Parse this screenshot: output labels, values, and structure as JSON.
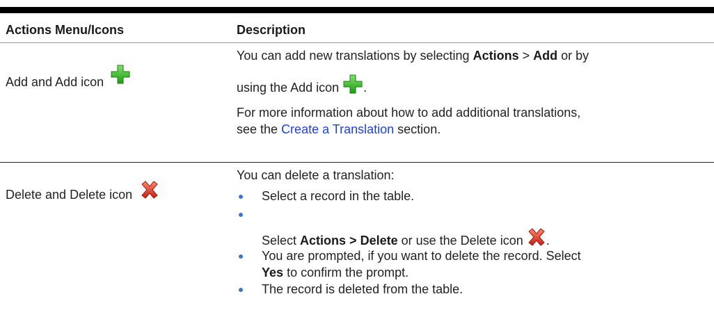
{
  "header": {
    "col1": "Actions Menu/Icons",
    "col2": "Description"
  },
  "row_add": {
    "label": "Add and Add icon",
    "icon": "green-plus-icon",
    "p1_text": "You can add new translations by selecting",
    "p1_b1": "Actions",
    "p1_sep": ">",
    "p1_b2": "Add",
    "p1_tail": "or by",
    "p2_text": "using the Add icon",
    "p2_end": ".",
    "p3_text": "For more information about how to add additional translations,",
    "p4_text": "see the",
    "p4_link": "Create a Translation",
    "p4_tail": "section."
  },
  "row_delete": {
    "label": "Delete and Delete icon",
    "icon": "red-x-icon",
    "intro": "You can delete a translation:",
    "b1": "Select a record in the table.",
    "b2_text": "Select",
    "b2_bold": "Actions > Delete",
    "b2_tail": "or use the Delete icon",
    "b2_end": ".",
    "b3_line1": "You are prompted, if you want to delete the record. Select",
    "b3_bold": "Yes",
    "b3_tail": "to confirm the prompt.",
    "b4": "The record is deleted from the table."
  },
  "colors": {
    "plus": "#3bbf2a",
    "x": "#d9372b",
    "link": "#1a44d8",
    "bullet": "#3a75c9"
  }
}
